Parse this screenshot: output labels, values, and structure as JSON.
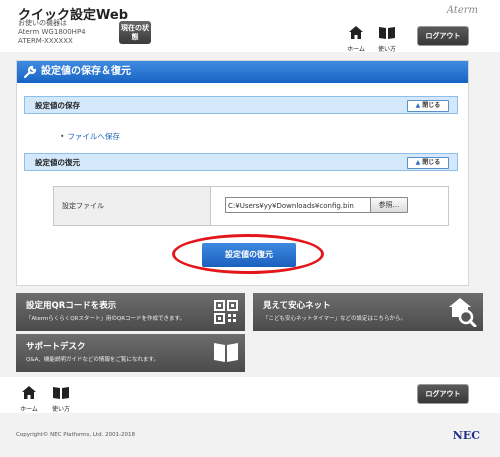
{
  "header": {
    "app_title": "クイック設定Web",
    "device_label": "お使いの機器は",
    "device_model": "Aterm WG1800HP4",
    "device_id": "ATERM-XXXXXX",
    "status_button": "現在の状態",
    "brand": "Aterm",
    "nav_home": "ホーム",
    "nav_manual": "使い方",
    "logout": "ログアウト"
  },
  "panel": {
    "title": "設定値の保存＆復元",
    "save_section": {
      "title": "設定値の保存",
      "close": "閉じる"
    },
    "save_link": "ファイルへ保存",
    "restore_section": {
      "title": "設定値の復元",
      "close": "閉じる"
    },
    "file_label": "設定ファイル",
    "file_value": "C:¥Users¥yy¥Downloads¥config.bin",
    "browse": "参照...",
    "restore_button": "設定値の復元"
  },
  "tiles": {
    "qr": {
      "title": "設定用QRコードを表示",
      "desc": "「AtermらくらくQRスタート」用のQRコードを作成できます。"
    },
    "safe": {
      "title": "見えて安心ネット",
      "desc": "「こども安心ネットタイマー」などの設定はこちらから。"
    },
    "support": {
      "title": "サポートデスク",
      "desc": "Q&A、機能説明ガイドなどの情報をご覧になれます。"
    }
  },
  "footer": {
    "nav_home": "ホーム",
    "nav_manual": "使い方",
    "logout": "ログアウト",
    "copyright": "Copyright© NEC Platforms, Ltd. 2001-2018",
    "brand": "NEC"
  }
}
